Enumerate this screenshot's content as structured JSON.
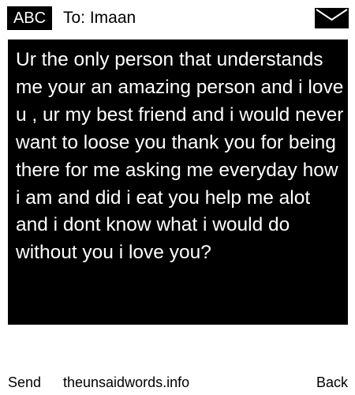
{
  "header": {
    "input_mode": "ABC",
    "recipient_label": "To: Imaan",
    "status_icon": "envelope-icon"
  },
  "message": {
    "body": "Ur the only person that understands me your an amazing person and i love u , ur my best friend and i would never want to loose you thank you for being there for me asking me everyday how i am and did i eat you help me alot and i dont know what i would do without you i love you?"
  },
  "footer": {
    "left_softkey": "Send",
    "site_name": "theunsaidwords.info",
    "right_softkey": "Back"
  },
  "colors": {
    "background": "#ffffff",
    "message_background": "#000000",
    "message_text": "#ffffff",
    "text": "#000000"
  }
}
